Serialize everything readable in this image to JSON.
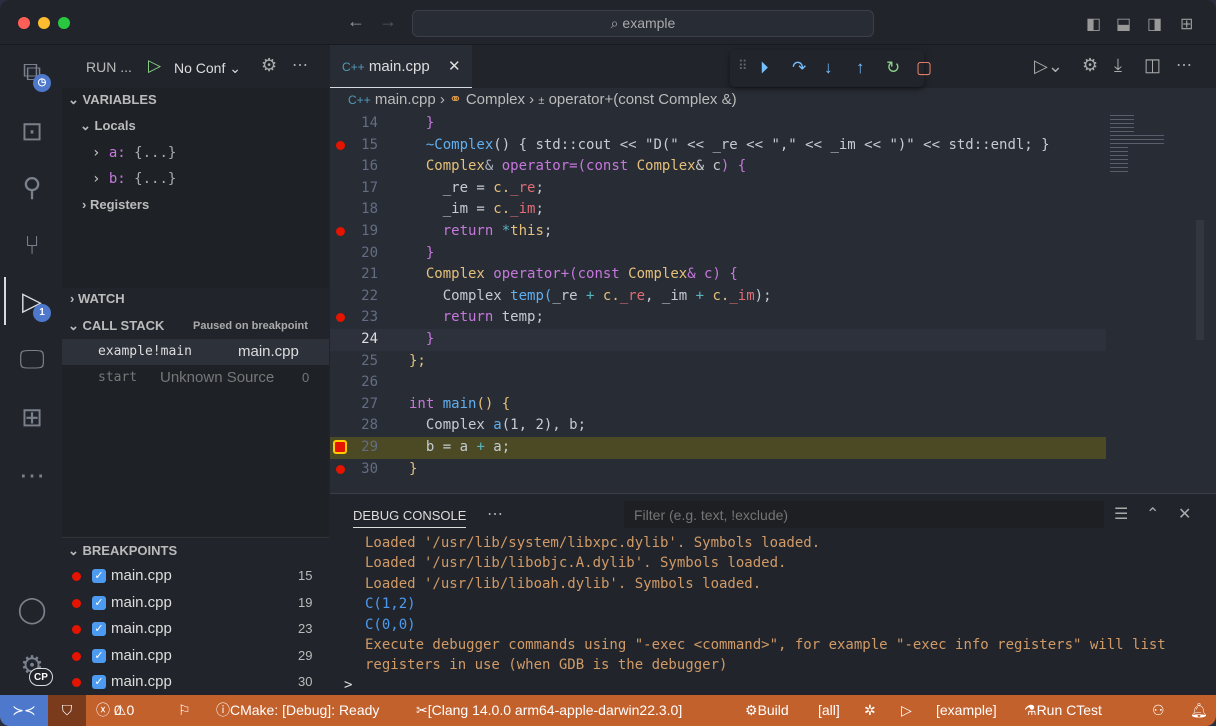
{
  "titlebar": {
    "search": "example",
    "search_icon": "search-icon"
  },
  "activity": {
    "debug_badge": "1",
    "account_badge": "CP"
  },
  "sidebar": {
    "run_label": "RUN ...",
    "config": "No Conf",
    "variables": "VARIABLES",
    "locals": "Locals",
    "vars": [
      {
        "name": "a:",
        "value": "{...}"
      },
      {
        "name": "b:",
        "value": "{...}"
      }
    ],
    "registers": "Registers",
    "watch": "WATCH",
    "callstack": "CALL STACK",
    "paused": "Paused on breakpoint",
    "frames": [
      {
        "name": "example!main",
        "source": "main.cpp",
        "line": ""
      },
      {
        "name": "start",
        "source": "Unknown Source",
        "line": "0"
      }
    ],
    "breakpoints": "BREAKPOINTS",
    "bps": [
      {
        "file": "main.cpp",
        "line": "15"
      },
      {
        "file": "main.cpp",
        "line": "19"
      },
      {
        "file": "main.cpp",
        "line": "23"
      },
      {
        "file": "main.cpp",
        "line": "29"
      },
      {
        "file": "main.cpp",
        "line": "30"
      }
    ]
  },
  "editor": {
    "tab": "main.cpp",
    "tab_icon": "C++",
    "breadcrumb": [
      "main.cpp",
      "Complex",
      "operator+(const Complex &)"
    ],
    "lines": [
      {
        "n": "14",
        "bp": false,
        "tokens": [
          [
            "  ",
            "p"
          ],
          [
            "}",
            "k"
          ]
        ]
      },
      {
        "n": "15",
        "bp": true,
        "tokens": [
          [
            "  ",
            "p"
          ],
          [
            "~Complex",
            "f"
          ],
          [
            "() { std::cout << \"D(\" << _re << \",\" << _im << \")\" << std::endl; }",
            "s"
          ]
        ]
      },
      {
        "n": "16",
        "bp": false,
        "tokens": [
          [
            "  ",
            "p"
          ],
          [
            "Complex",
            "ty"
          ],
          [
            "& ",
            "p"
          ],
          [
            "operator=",
            "k"
          ],
          [
            "(",
            "k"
          ],
          [
            "const ",
            "k"
          ],
          [
            "Complex",
            "ty"
          ],
          [
            "& c",
            ""
          ],
          [
            ") {",
            "k"
          ]
        ]
      },
      {
        "n": "17",
        "bp": false,
        "tokens": [
          [
            "    _re = ",
            "s"
          ],
          [
            "c.",
            "ty"
          ],
          [
            "_re",
            "m"
          ],
          [
            ";",
            "s"
          ]
        ]
      },
      {
        "n": "18",
        "bp": false,
        "tokens": [
          [
            "    _im = ",
            "s"
          ],
          [
            "c.",
            "ty"
          ],
          [
            "_im",
            "m"
          ],
          [
            ";",
            "s"
          ]
        ]
      },
      {
        "n": "19",
        "bp": true,
        "tokens": [
          [
            "    ",
            "p"
          ],
          [
            "return ",
            "k"
          ],
          [
            "*",
            "o"
          ],
          [
            "this",
            "ty"
          ],
          [
            ";",
            "s"
          ]
        ]
      },
      {
        "n": "20",
        "bp": false,
        "tokens": [
          [
            "  ",
            "p"
          ],
          [
            "}",
            "k"
          ]
        ]
      },
      {
        "n": "21",
        "bp": false,
        "tokens": [
          [
            "  ",
            "p"
          ],
          [
            "Complex ",
            "ty"
          ],
          [
            "operator+",
            "k"
          ],
          [
            "(const ",
            "k"
          ],
          [
            "Complex",
            "ty"
          ],
          [
            "& c) ",
            "k"
          ],
          [
            "{",
            "k"
          ]
        ]
      },
      {
        "n": "22",
        "bp": false,
        "tokens": [
          [
            "    Complex ",
            "s"
          ],
          [
            "temp",
            "f"
          ],
          [
            "(",
            "f"
          ],
          [
            "_re ",
            "s"
          ],
          [
            "+ ",
            "o"
          ],
          [
            "c.",
            "ty"
          ],
          [
            "_re",
            "m"
          ],
          [
            ", _im ",
            "s"
          ],
          [
            "+ ",
            "o"
          ],
          [
            "c.",
            "ty"
          ],
          [
            "_im",
            "m"
          ],
          [
            ");",
            "s"
          ]
        ]
      },
      {
        "n": "23",
        "bp": true,
        "tokens": [
          [
            "    ",
            "p"
          ],
          [
            "return ",
            "k"
          ],
          [
            "temp;",
            "s"
          ]
        ]
      },
      {
        "n": "24",
        "bp": false,
        "tokens": [
          [
            "  ",
            "p"
          ],
          [
            "}",
            "k"
          ]
        ]
      },
      {
        "n": "25",
        "bp": false,
        "tokens": [
          [
            "};",
            "ty"
          ]
        ]
      },
      {
        "n": "26",
        "bp": false,
        "tokens": []
      },
      {
        "n": "27",
        "bp": false,
        "tokens": [
          [
            "int ",
            "k"
          ],
          [
            "main",
            "f"
          ],
          [
            "() {",
            "ty"
          ]
        ]
      },
      {
        "n": "28",
        "bp": false,
        "tokens": [
          [
            "  Complex ",
            "s"
          ],
          [
            "a",
            "f"
          ],
          [
            "(1, 2), b;",
            "s"
          ]
        ]
      },
      {
        "n": "29",
        "bp": true,
        "tokens": [
          [
            "  b = a ",
            "s"
          ],
          [
            "+ ",
            "o"
          ],
          [
            "a;",
            "s"
          ]
        ]
      },
      {
        "n": "30",
        "bp": true,
        "tokens": [
          [
            "}",
            "ty"
          ]
        ]
      }
    ]
  },
  "panel": {
    "title": "DEBUG CONSOLE",
    "filter_placeholder": "Filter (e.g. text, !exclude)",
    "lines": [
      {
        "t": "Loaded '/usr/lib/system/libxpc.dylib'. Symbols loaded.",
        "c": "#d19a66"
      },
      {
        "t": "Loaded '/usr/lib/libobjc.A.dylib'. Symbols loaded.",
        "c": "#d19a66"
      },
      {
        "t": "Loaded '/usr/lib/liboah.dylib'. Symbols loaded.",
        "c": "#d19a66"
      },
      {
        "t": "C(1,2)",
        "c": "#4d9bf0"
      },
      {
        "t": "C(0,0)",
        "c": "#4d9bf0"
      },
      {
        "t": "Execute debugger commands using \"-exec <command>\", for example \"-exec info registers\" will list",
        "c": "#d19a66"
      },
      {
        "t": "registers in use (when GDB is the debugger)",
        "c": "#d19a66"
      }
    ],
    "prompt": ">"
  },
  "status": {
    "errors": "0",
    "warnings": "0",
    "cmake": "CMake: [Debug]: Ready",
    "kit": "[Clang 14.0.0 arm64-apple-darwin22.3.0]",
    "build": "Build",
    "target": "[all]",
    "launch": "[example]",
    "ctest": "Run CTest"
  },
  "colors": {
    "status_bg": "#c3612d",
    "breakpoint": "#e51400",
    "current_line": "#4b4a25",
    "accent": "#4d78cc"
  }
}
